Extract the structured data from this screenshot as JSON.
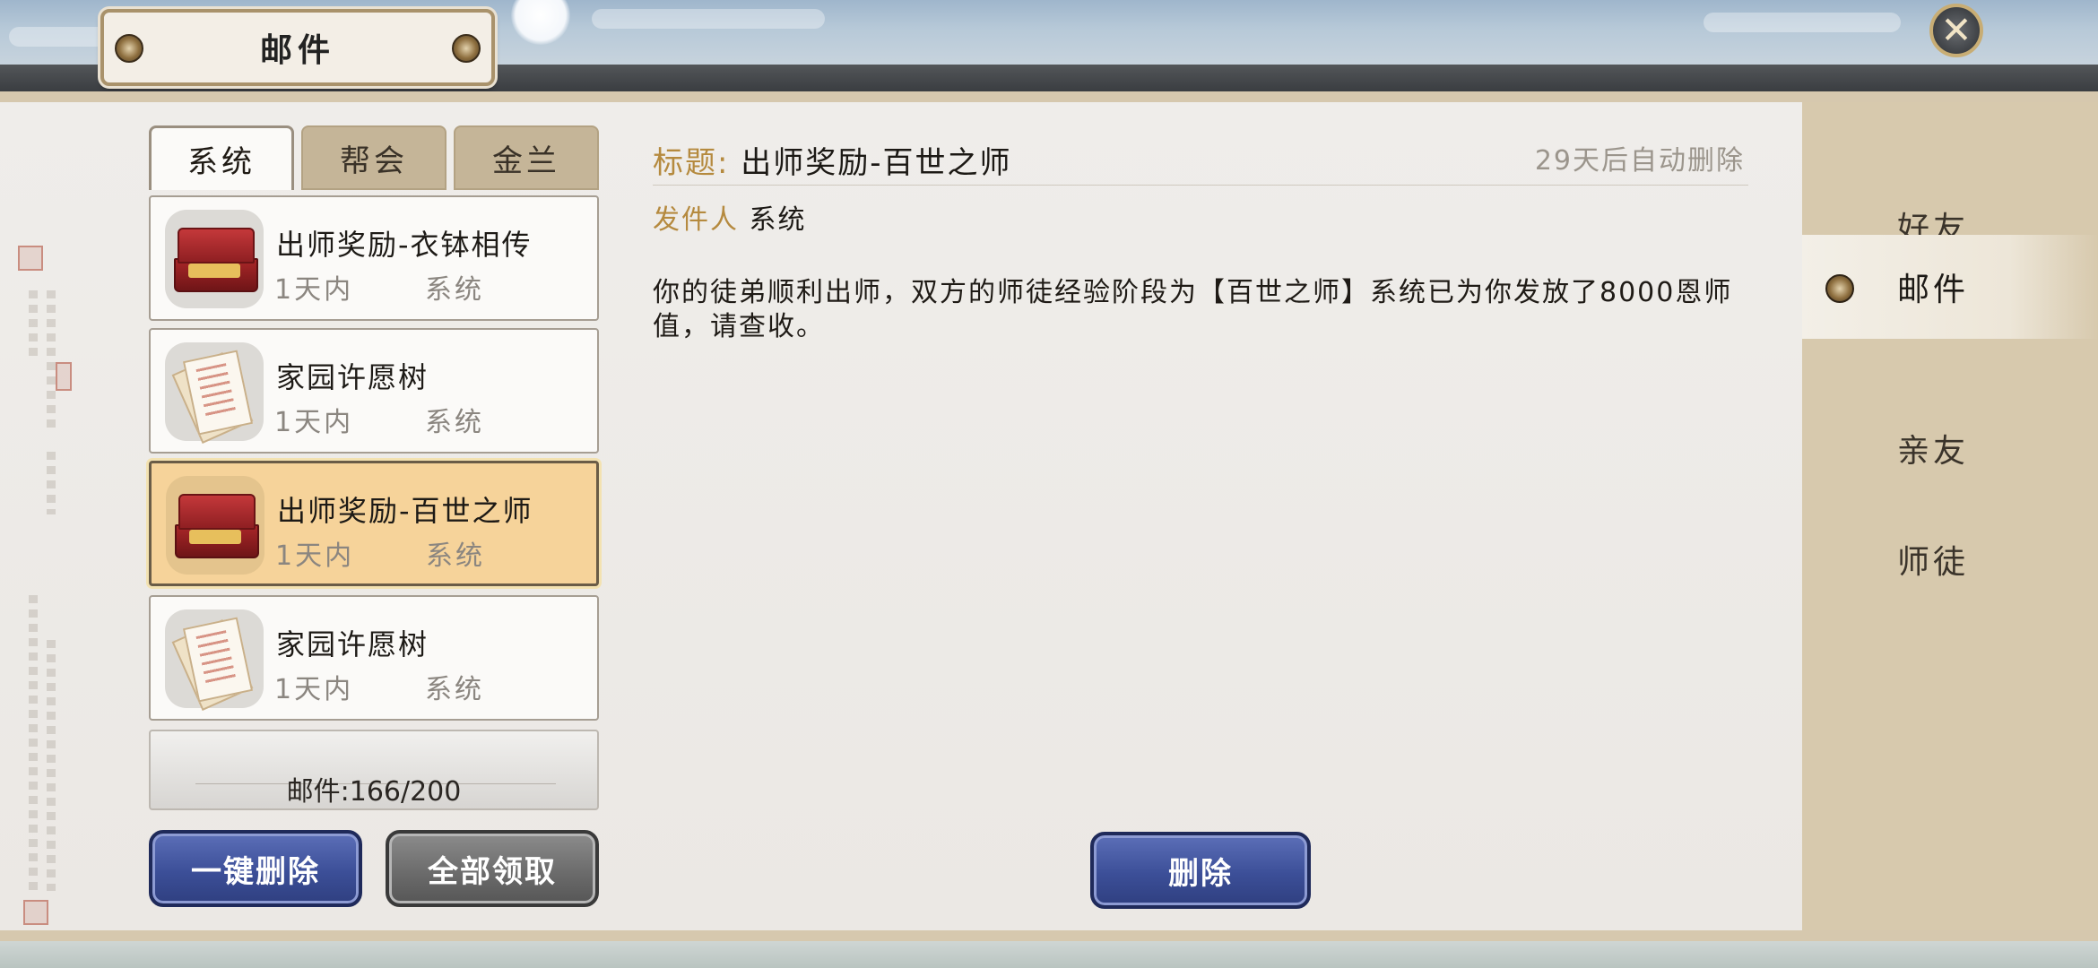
{
  "header": {
    "title": "邮件",
    "close_icon": "close-icon"
  },
  "tabs": [
    {
      "label": "系统",
      "active": true
    },
    {
      "label": "帮会",
      "active": false
    },
    {
      "label": "金兰",
      "active": false
    }
  ],
  "mail_list": [
    {
      "title": "出师奖励-衣钵相传",
      "time": "1天内",
      "sender": "系统",
      "icon": "gift-box-icon",
      "selected": false
    },
    {
      "title": "家园许愿树",
      "time": "1天内",
      "sender": "系统",
      "icon": "letter-scroll-icon",
      "selected": false
    },
    {
      "title": "出师奖励-百世之师",
      "time": "1天内",
      "sender": "系统",
      "icon": "gift-box-icon",
      "selected": true
    },
    {
      "title": "家园许愿树",
      "time": "1天内",
      "sender": "系统",
      "icon": "letter-scroll-icon",
      "selected": false
    }
  ],
  "mail_count": "邮件:166/200",
  "buttons": {
    "delete_all": "一键删除",
    "claim_all": "全部领取",
    "delete": "删除"
  },
  "detail": {
    "title_label": "标题:",
    "title_value": "出师奖励-百世之师",
    "auto_delete": "29天后自动删除",
    "sender_label": "发件人",
    "sender_value": "系统",
    "body": "你的徒弟顺利出师，双方的师徒经验阶段为【百世之师】系统已为你发放了8000恩师值，请查收。"
  },
  "right_nav": [
    {
      "label": "好友",
      "active": false
    },
    {
      "label": "邮件",
      "active": true
    },
    {
      "label": "亲友",
      "active": false
    },
    {
      "label": "师徒",
      "active": false
    }
  ],
  "colors": {
    "accent_gold": "#b58a3f",
    "selected_item": "#f6d39a",
    "button_blue": "#3c4f98",
    "button_gray": "#6c6c6c"
  }
}
